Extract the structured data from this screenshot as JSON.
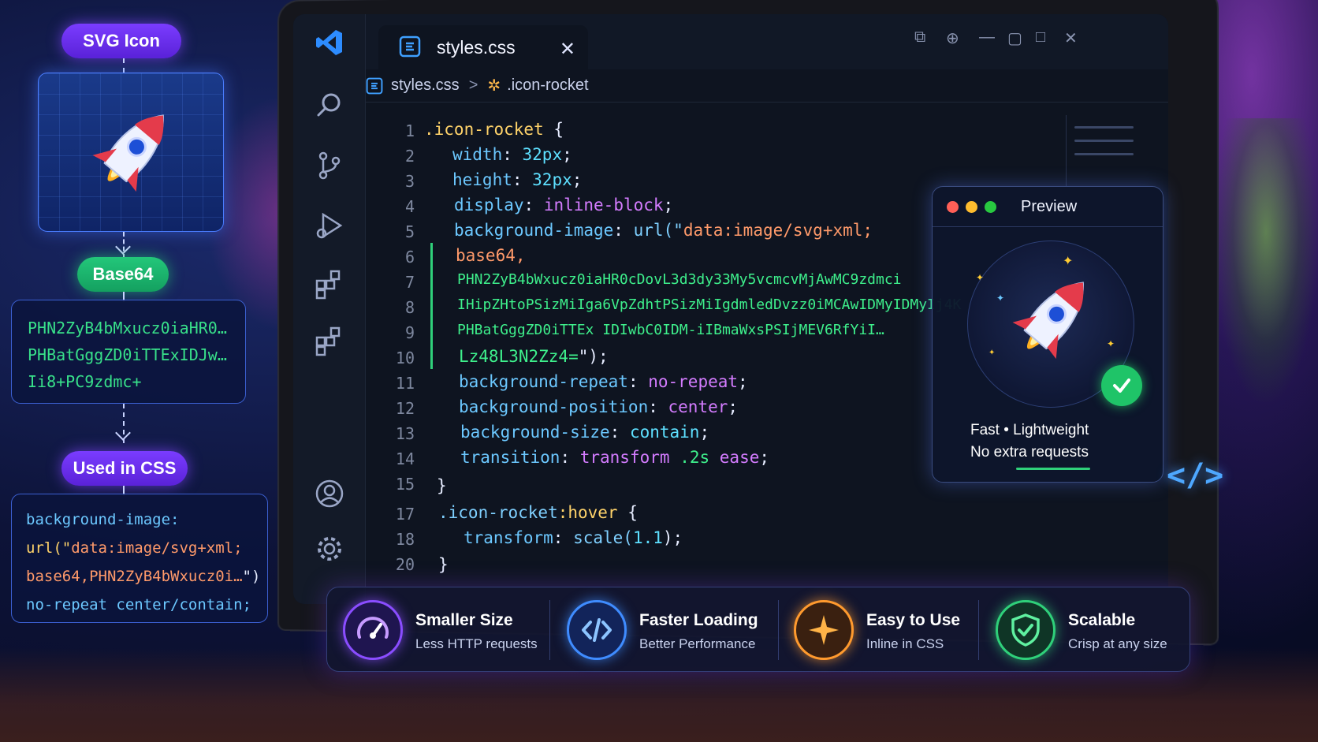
{
  "flow": {
    "svg_icon_label": "SVG Icon",
    "base64_label": "Base64",
    "base64_lines": [
      "PHN2ZyB4bMxucz0iaHR0…",
      "PHBatGggZD0iTTExIDJw…",
      "Ii8+PC9zdmc+"
    ],
    "used_in_css_label": "Used in CSS",
    "css_snippet": {
      "line1": "background-image:",
      "line2_a": "url(\"",
      "line2_b": "data:image/svg+xml;",
      "line3_a": "base64,PHN2ZyB4bWxucz0i…",
      "line3_b": "\")",
      "line4": "no-repeat center/contain;"
    }
  },
  "editor": {
    "tab_title": "styles.css",
    "breadcrumb_file": "styles.css",
    "breadcrumb_separator": ">",
    "breadcrumb_symbol": ".icon-rocket",
    "line_numbers": [
      "1",
      "2",
      "3",
      "4",
      "5",
      "6",
      "7",
      "8",
      "9",
      "10",
      "11",
      "12",
      "13",
      "14",
      "15",
      "17",
      "18",
      "20"
    ],
    "code": {
      "l1_sel": ".icon-rocket",
      "l1_brace": "{",
      "l2_prop": "width",
      "l2_val": "32px",
      "l3_prop": "height",
      "l3_val": "32px",
      "l4_prop": "display",
      "l4_val": "inline-block",
      "l5_prop": "background-image",
      "l5_fn": "url(\"",
      "l5_str": "data:image/svg+xml;",
      "l6": "base64,",
      "l7": "PHN2ZyB4bWxucz0iaHR0cDovL3d3dy33My5vcmcvMjAwMC9zdmci",
      "l8": "IHipZHtoPSizMiIga6VpZdhtPSizMiIgdmledDvzz0iMCAwIDMyIDMyIj4K",
      "l9": "PHBatGggZD0iTTEx IDIwbC0IDM-iIBmaWxsPSIjMEV6RfYiI…",
      "l10_str": "Lz48L3N2Zz4=",
      "l10_end": "\");",
      "l11_prop": "background-repeat",
      "l11_val": "no-repeat",
      "l12_prop": "background-position",
      "l12_val": "center",
      "l13_prop": "background-size",
      "l13_val": "contain",
      "l14_prop": "transition",
      "l14_val1": "transform",
      "l14_val2": ".2s",
      "l14_val3": "ease",
      "l15": "}",
      "l17_sel": ".icon-rocket",
      "l17_pseudo": ":hover",
      "l17_brace": "{",
      "l18_prop": "transform",
      "l18_fn": "scale(",
      "l18_num": "1.1",
      "l18_end": ");",
      "l20": "}"
    }
  },
  "preview": {
    "title": "Preview",
    "line1": "Fast  •  Lightweight",
    "line2": "No extra requests"
  },
  "features": [
    {
      "title": "Smaller Size",
      "subtitle": "Less HTTP requests",
      "icon": "gauge-icon",
      "color": "#8a4dff"
    },
    {
      "title": "Faster Loading",
      "subtitle": "Better Performance",
      "icon": "code-brackets-icon",
      "color": "#3f8cff"
    },
    {
      "title": "Easy to Use",
      "subtitle": "Inline in CSS",
      "icon": "sparkle-icon",
      "color": "#ff9a2e"
    },
    {
      "title": "Scalable",
      "subtitle": "Crisp at any size",
      "icon": "shield-check-icon",
      "color": "#2fd07a"
    }
  ],
  "colors": {
    "accent_purple": "#7a3cff",
    "accent_green": "#23c77a",
    "editor_bg": "#0e1420"
  }
}
